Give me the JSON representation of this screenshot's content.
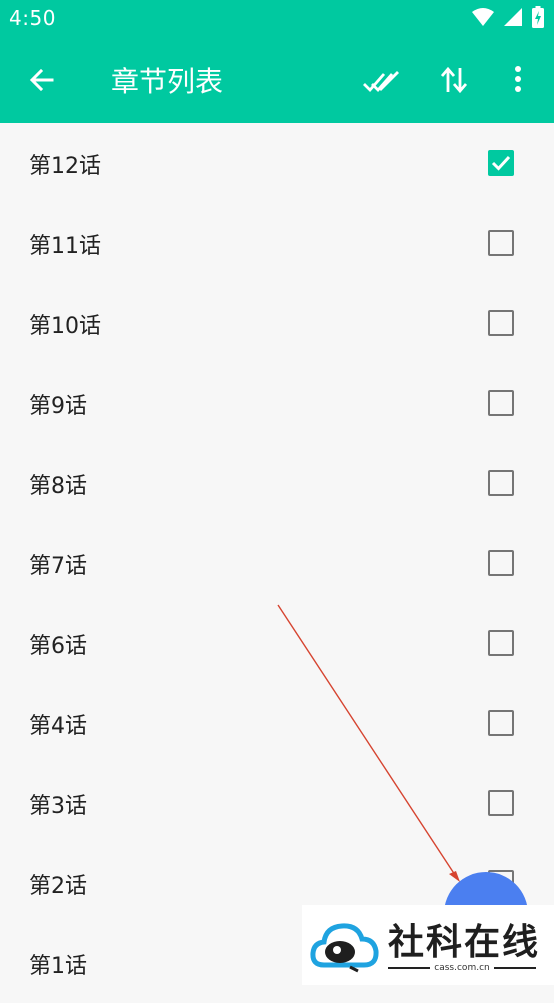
{
  "status_bar": {
    "time": "4:50",
    "icons": [
      "wifi-icon",
      "signal-icon",
      "battery-charging-icon"
    ]
  },
  "app_bar": {
    "title": "章节列表",
    "actions": [
      "back-arrow-icon",
      "select-all-icon",
      "sort-icon",
      "more-vert-icon"
    ],
    "color": "#00c9a0"
  },
  "chapters": [
    {
      "label": "第12话",
      "checked": true
    },
    {
      "label": "第11话",
      "checked": false
    },
    {
      "label": "第10话",
      "checked": false
    },
    {
      "label": "第9话",
      "checked": false
    },
    {
      "label": "第8话",
      "checked": false
    },
    {
      "label": "第7话",
      "checked": false
    },
    {
      "label": "第6话",
      "checked": false
    },
    {
      "label": "第4话",
      "checked": false
    },
    {
      "label": "第3话",
      "checked": false
    },
    {
      "label": "第2话",
      "checked": false
    },
    {
      "label": "第1话",
      "checked": false
    }
  ],
  "fab": {
    "color": "#4b7ff0"
  },
  "watermark": {
    "text": "社科在线",
    "domain": "cass.com.cn"
  }
}
